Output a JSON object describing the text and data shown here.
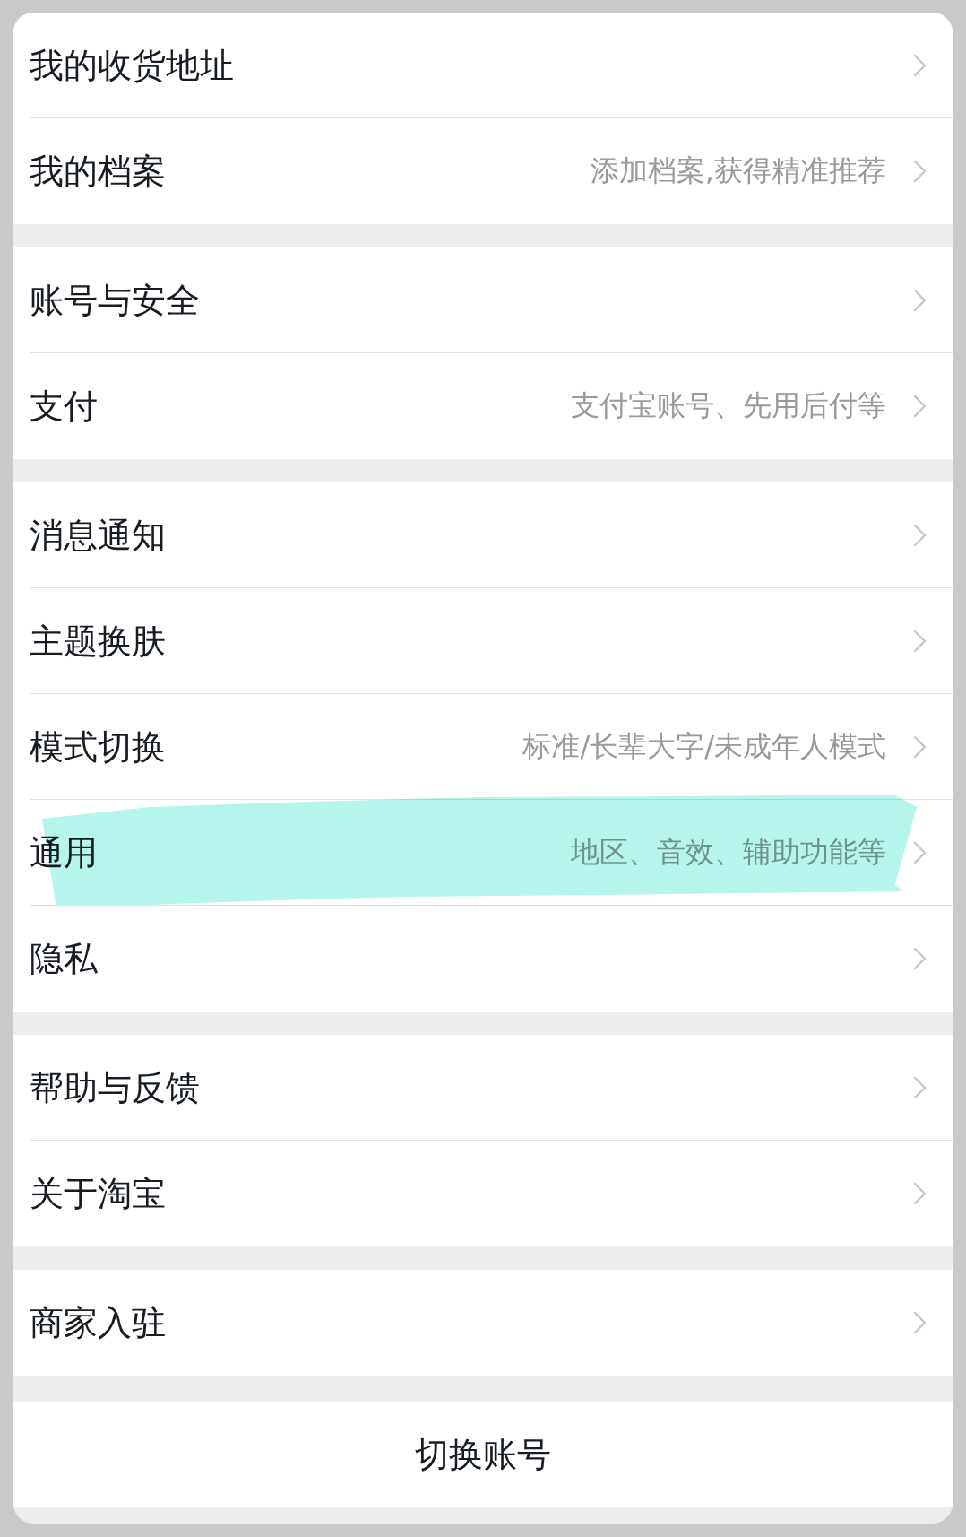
{
  "sections": [
    {
      "items": [
        {
          "title": "我的收货地址",
          "highlighted": false
        },
        {
          "title": "我的档案",
          "hint": "添加档案,获得精准推荐",
          "highlighted": false
        }
      ]
    },
    {
      "items": [
        {
          "title": "账号与安全",
          "highlighted": false
        },
        {
          "title": "支付",
          "hint": "支付宝账号、先用后付等",
          "highlighted": false
        }
      ]
    },
    {
      "items": [
        {
          "title": "消息通知",
          "highlighted": false
        },
        {
          "title": "主题换肤",
          "highlighted": false
        },
        {
          "title": "模式切换",
          "hint": "标准/长辈大字/未成年人模式",
          "highlighted": false
        },
        {
          "title": "通用",
          "hint": "地区、音效、辅助功能等",
          "highlighted": true
        },
        {
          "title": "隐私",
          "highlighted": false
        }
      ]
    },
    {
      "items": [
        {
          "title": "帮助与反馈",
          "highlighted": false
        },
        {
          "title": "关于淘宝",
          "highlighted": false
        }
      ]
    },
    {
      "items": [
        {
          "title": "商家入驻",
          "highlighted": false
        }
      ]
    }
  ],
  "switch_account_button": {
    "label": "切换账号"
  }
}
